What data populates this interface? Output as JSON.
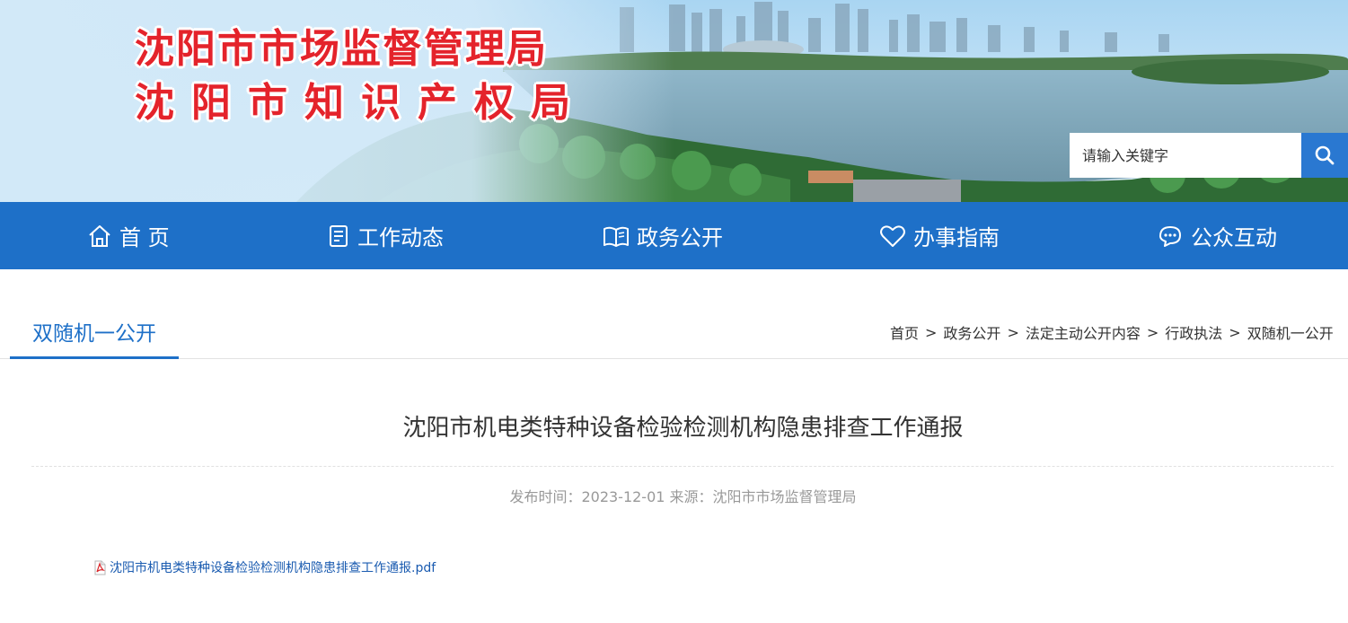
{
  "header": {
    "title_line1": "沈阳市市场监督管理局",
    "title_line2": "沈阳市知识产权局",
    "search": {
      "placeholder": "请输入关键字",
      "button_icon": "search-icon"
    }
  },
  "nav": {
    "items": [
      {
        "label": "首 页",
        "icon": "home-icon"
      },
      {
        "label": "工作动态",
        "icon": "document-icon"
      },
      {
        "label": "政务公开",
        "icon": "book-icon"
      },
      {
        "label": "办事指南",
        "icon": "heart-icon"
      },
      {
        "label": "公众互动",
        "icon": "chat-icon"
      }
    ]
  },
  "section": {
    "tab_label": "双随机一公开",
    "breadcrumb": [
      "首页",
      "政务公开",
      "法定主动公开内容",
      "行政执法",
      "双随机一公开"
    ],
    "separator": ">"
  },
  "article": {
    "title": "沈阳市机电类特种设备检验检测机构隐患排查工作通报",
    "meta": "发布时间：2023-12-01 来源：沈阳市市场监督管理局",
    "attachment": {
      "name": "沈阳市机电类特种设备检验检测机构隐患排查工作通报.pdf",
      "icon": "pdf-icon"
    }
  },
  "colors": {
    "brand_blue": "#1e70c8",
    "title_red": "#e4232b",
    "link_blue": "#1a5bb0"
  }
}
